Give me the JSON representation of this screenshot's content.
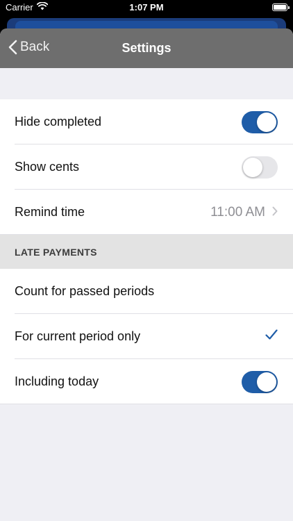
{
  "status_bar": {
    "carrier": "Carrier",
    "time": "1:07 PM",
    "wifi_icon": "wifi-icon",
    "battery_icon": "battery-icon"
  },
  "navbar": {
    "back_label": "Back",
    "title": "Settings"
  },
  "general": {
    "hide_completed": {
      "label": "Hide completed",
      "on": true
    },
    "show_cents": {
      "label": "Show cents",
      "on": false
    },
    "remind_time": {
      "label": "Remind time",
      "value": "11:00 AM"
    }
  },
  "late_payments": {
    "header": "LATE PAYMENTS",
    "options": [
      {
        "label": "Count for passed periods",
        "selected": false
      },
      {
        "label": "For current period only",
        "selected": true
      }
    ],
    "including_today": {
      "label": "Including today",
      "on": true
    }
  },
  "colors": {
    "accent": "#1f5da8",
    "navbar": "#6e6e6e",
    "background": "#efeff4"
  }
}
